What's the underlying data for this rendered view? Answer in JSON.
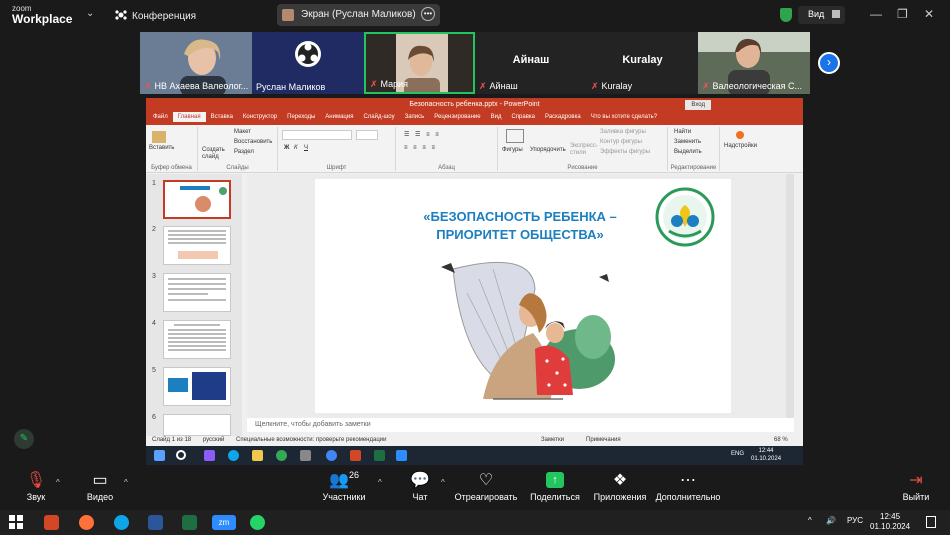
{
  "app": {
    "brand_top": "zoom",
    "brand_bottom": "Workplace",
    "meeting_label": "Конференция"
  },
  "share": {
    "label": "Экран (Руслан Маликов)"
  },
  "view": {
    "label": "Вид"
  },
  "participants_strip": [
    {
      "name": "НВ Ахаева Валеолог...",
      "muted": true
    },
    {
      "name": "Руслан Маликов",
      "muted": false
    },
    {
      "name": "Мария",
      "muted": true,
      "active_speaker": true
    },
    {
      "name": "Айнаш",
      "muted": true,
      "big_label": "Айнаш"
    },
    {
      "name": "Kuralay",
      "muted": true,
      "big_label": "Kuralay"
    },
    {
      "name": "Валеологическая С...",
      "muted": true
    }
  ],
  "ppt": {
    "title": "Безопасность ребенка.pptx - PowerPoint",
    "signin": "Вход",
    "tabs": [
      "Файл",
      "Главная",
      "Вставка",
      "Конструктор",
      "Переходы",
      "Анимация",
      "Слайд-шоу",
      "Запись",
      "Рецензирование",
      "Вид",
      "Справка",
      "Раскадровка",
      "Что вы хотите сделать?"
    ],
    "ribbon": {
      "paste": "Вставить",
      "clipboard": "Буфер обмена",
      "new_slide": "Создать слайд",
      "layout": "Макет",
      "reset": "Восстановить",
      "section": "Раздел",
      "slides": "Слайды",
      "font": "Шрифт",
      "paragraph": "Абзац",
      "shapes": "Фигуры",
      "arrange": "Упорядочить",
      "quick_styles": "Экспресс-стили",
      "fill": "Заливка фигуры",
      "outline": "Контур фигуры",
      "effects": "Эффекты фигуры",
      "drawing": "Рисование",
      "find": "Найти",
      "replace": "Заменить",
      "select": "Выделить",
      "editing": "Редактирование",
      "addins": "Надстройки"
    },
    "slide_numbers": [
      "1",
      "2",
      "3",
      "4",
      "5",
      "6"
    ],
    "slide_title": "«БЕЗОПАСНОСТЬ РЕБЕНКА – ПРИОРИТЕТ ОБЩЕСТВА»",
    "notes_placeholder": "Щелкните, чтобы добавить заметки",
    "status": {
      "slide": "Слайд 1 из 18",
      "lang": "русский",
      "accessibility": "Специальные возможности: проверьте рекомендации",
      "notes": "Заметки",
      "comments": "Примечания",
      "zoom": "68 %"
    },
    "inner_clock": {
      "time": "12:44",
      "date": "01.10.2024",
      "lang": "ENG"
    }
  },
  "toolbar": {
    "audio": "Звук",
    "video": "Видео",
    "participants": "Участники",
    "participants_count": "26",
    "chat": "Чат",
    "react": "Отреагировать",
    "share": "Поделиться",
    "apps": "Приложения",
    "more": "Дополнительно",
    "leave": "Выйти"
  },
  "taskbar": {
    "lang": "РУС",
    "time": "12:45",
    "date": "01.10.2024"
  },
  "colors": {
    "accent": "#c23b22",
    "zoom_blue": "#1a73e8",
    "share_green": "#23c55e",
    "title_blue": "#1b7fc0"
  }
}
